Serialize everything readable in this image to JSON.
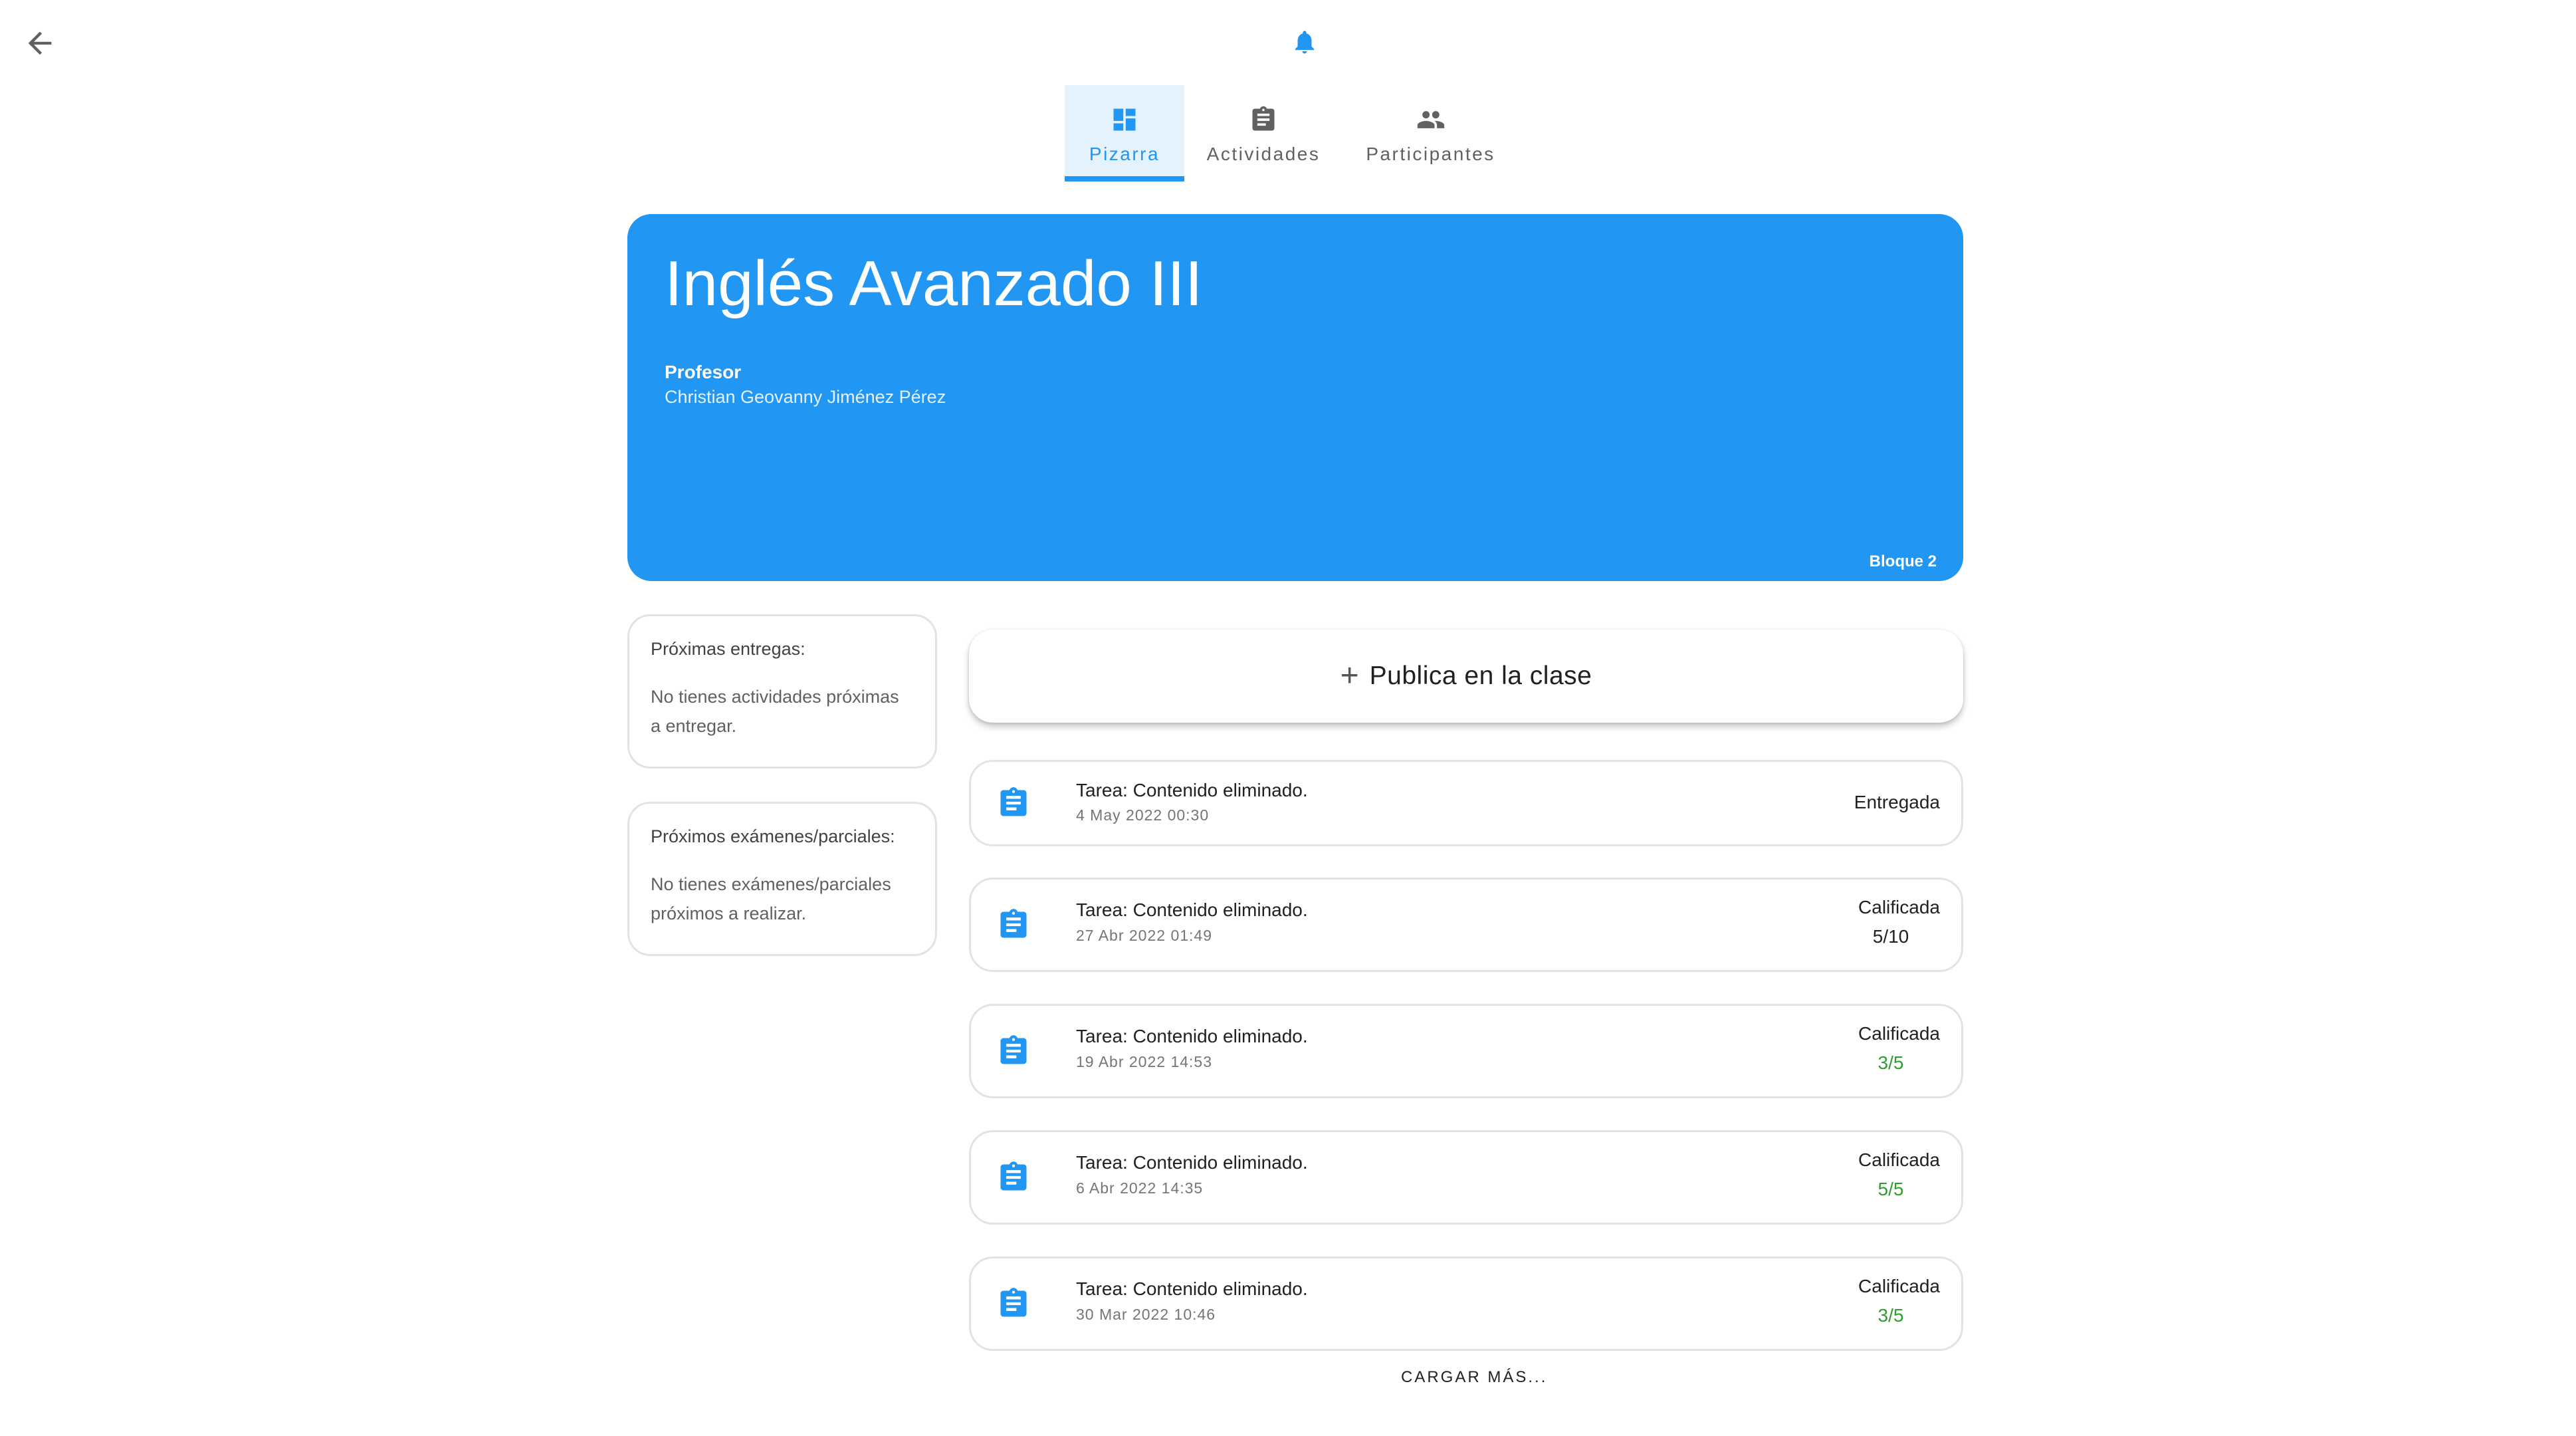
{
  "icons": {
    "back": "arrow-back-icon",
    "notifications": "bell-icon",
    "task": "assignment-icon"
  },
  "colors": {
    "primary": "#2196f3",
    "primary_light": "#e3f2fd",
    "grade_green": "#2e9e2e",
    "text": "#212121",
    "muted": "#757575"
  },
  "tabs": [
    {
      "label": "Pizarra",
      "icon": "dashboard-icon",
      "active": true
    },
    {
      "label": "Actividades",
      "icon": "assignment-icon",
      "active": false
    },
    {
      "label": "Participantes",
      "icon": "people-icon",
      "active": false
    }
  ],
  "banner": {
    "title": "Inglés Avanzado III",
    "professor_label": "Profesor",
    "professor_name": "Christian Geovanny Jiménez Pérez",
    "block": "Bloque 2"
  },
  "sidebar": {
    "upcoming_deliveries": {
      "title": "Próximas entregas:",
      "text": "No tienes actividades próximas a entregar."
    },
    "upcoming_exams": {
      "title": "Próximos exámenes/parciales:",
      "text": "No tienes exámenes/parciales próximos a realizar."
    }
  },
  "publish": {
    "label": "Publica en la clase"
  },
  "feed": [
    {
      "title": "Tarea: Contenido eliminado.",
      "date": "4 May 2022 00:30",
      "status": "Entregada",
      "grade": ""
    },
    {
      "title": "Tarea: Contenido eliminado.",
      "date": "27 Abr 2022 01:49",
      "status": "Calificada",
      "grade": "5/10"
    },
    {
      "title": "Tarea: Contenido eliminado.",
      "date": "19 Abr 2022 14:53",
      "status": "Calificada",
      "grade": "3/5"
    },
    {
      "title": "Tarea: Contenido eliminado.",
      "date": "6 Abr 2022 14:35",
      "status": "Calificada",
      "grade": "5/5"
    },
    {
      "title": "Tarea: Contenido eliminado.",
      "date": "30 Mar 2022 10:46",
      "status": "Calificada",
      "grade": "3/5"
    }
  ],
  "load_more": "CARGAR MÁS..."
}
